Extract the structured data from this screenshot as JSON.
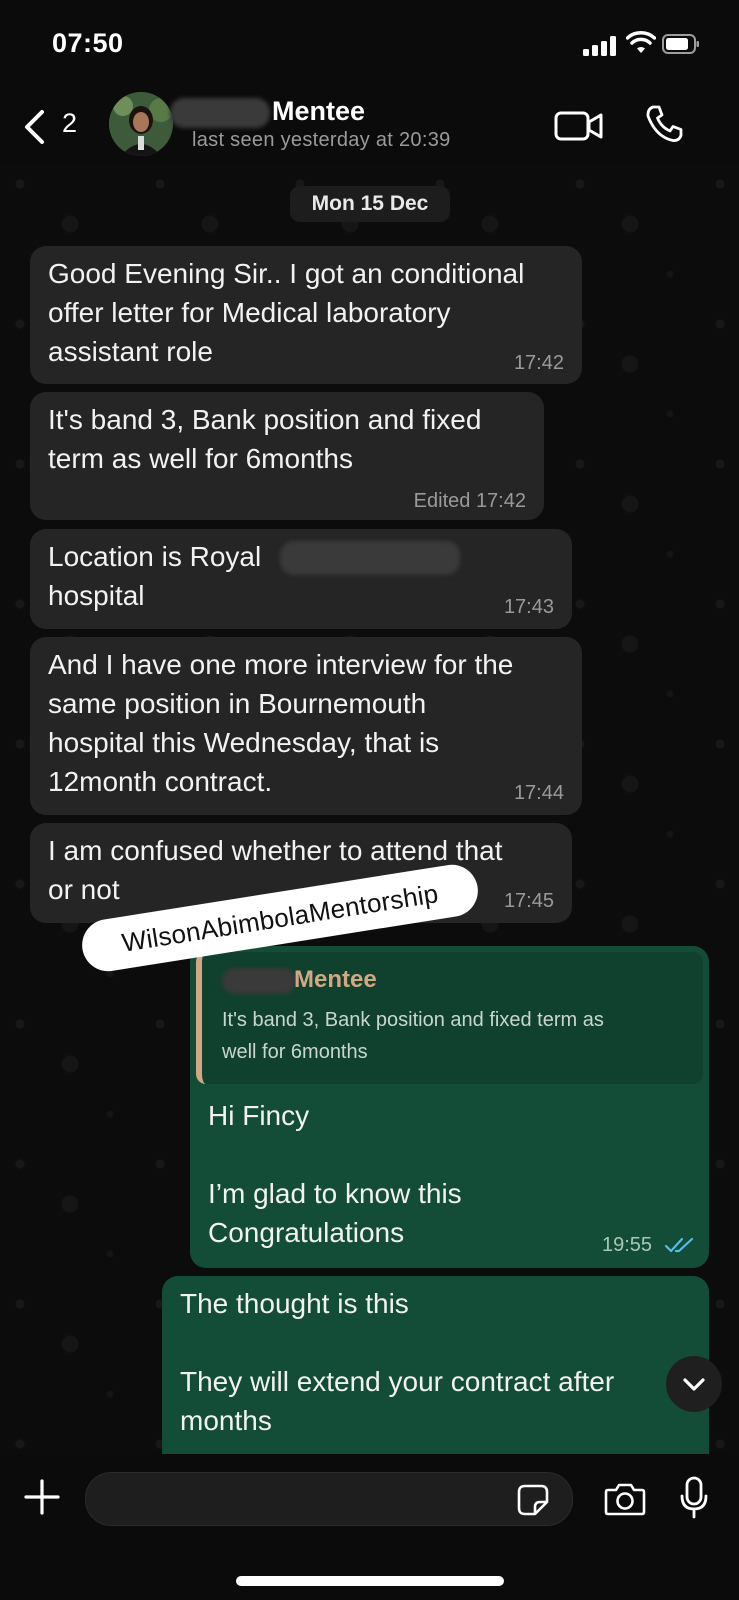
{
  "status_bar": {
    "time": "07:50"
  },
  "header": {
    "back_count": "2",
    "contact_name": "Mentee",
    "last_seen": "last seen yesterday at 20:39"
  },
  "chat": {
    "date_label": "Mon 15 Dec",
    "incoming": [
      {
        "lines": [
          "Good Evening Sir.. I got an conditional",
          "offer letter for Medical laboratory",
          "assistant role"
        ],
        "time": "17:42"
      },
      {
        "lines": [
          "It's band 3, Bank position and fixed",
          "term as well for 6months"
        ],
        "time": "Edited 17:42"
      },
      {
        "lines": [
          "Location is Royal",
          "hospital"
        ],
        "time": "17:43"
      },
      {
        "lines": [
          "And  I have one more interview for the",
          "same position in Bournemouth",
          "hospital this Wednesday, that is",
          "12month contract."
        ],
        "time": "17:44"
      },
      {
        "lines": [
          "I am confused whether to attend that",
          "or not"
        ],
        "time": "17:45"
      }
    ],
    "outgoing": [
      {
        "reply_name": "Mentee",
        "reply_lines": [
          "It's band 3, Bank position and fixed term as",
          "well for 6months"
        ],
        "lines": [
          "Hi Fincy",
          "",
          "I’m glad to know this",
          "Congratulations"
        ],
        "time": "19:55"
      },
      {
        "lines": [
          "The thought is this",
          "",
          "They will extend your contract after",
          "months"
        ]
      }
    ],
    "watermark": "WilsonAbimbolaMentorship"
  },
  "colors": {
    "incoming_bubble": "#252525",
    "outgoing_bubble": "#144d37",
    "reply_accent": "#d2a883",
    "read_ticks": "#53bdeb"
  },
  "icons": [
    "back-chevron-icon",
    "video-call-icon",
    "phone-icon",
    "plus-icon",
    "sticker-icon",
    "camera-icon",
    "microphone-icon",
    "chevron-down-icon"
  ]
}
